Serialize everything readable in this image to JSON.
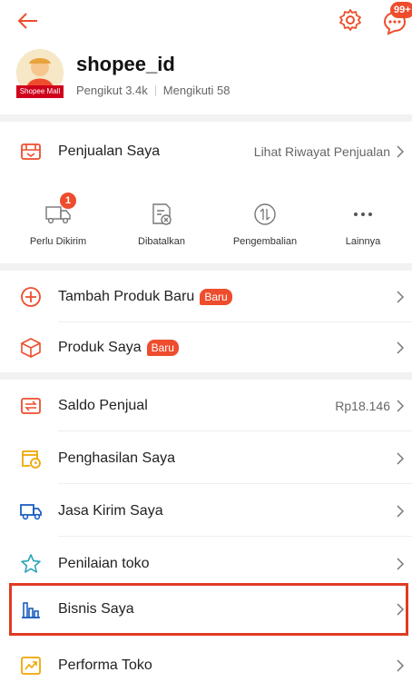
{
  "header": {
    "chat_badge": "99+"
  },
  "profile": {
    "shop_name": "shopee_id",
    "followers": "Pengikut 3.4k",
    "following": "Mengikuti 58",
    "mall_tag": "Shopee Mall"
  },
  "sales": {
    "label": "Penjualan Saya",
    "right_text": "Lihat Riwayat Penjualan",
    "sub": [
      {
        "label": "Perlu Dikirim",
        "badge": "1"
      },
      {
        "label": "Dibatalkan"
      },
      {
        "label": "Pengembalian"
      },
      {
        "label": "Lainnya"
      }
    ]
  },
  "products": {
    "add_label": "Tambah Produk Baru",
    "add_badge": "Baru",
    "my_label": "Produk Saya",
    "my_badge": "Baru"
  },
  "menu": {
    "saldo_label": "Saldo Penjual",
    "saldo_value": "Rp18.146",
    "income_label": "Penghasilan Saya",
    "shipping_label": "Jasa Kirim Saya",
    "rating_label": "Penilaian toko",
    "business_label": "Bisnis Saya",
    "performance_label": "Performa Toko"
  },
  "colors": {
    "accent": "#ee4d2d",
    "highlight": "#e03a24"
  }
}
